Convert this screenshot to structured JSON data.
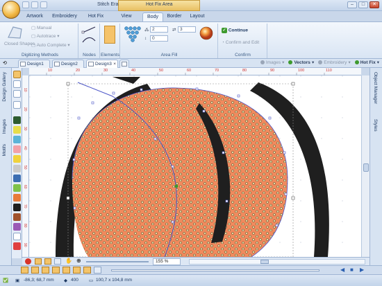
{
  "window": {
    "title": "Stitch Era",
    "contextual_group": "Hot Fix Area",
    "controls": [
      "–",
      "□",
      "✕"
    ]
  },
  "ribbon_tabs": [
    {
      "label": "Artwork",
      "active": false
    },
    {
      "label": "Embroidery",
      "active": false
    },
    {
      "label": "Hot Fix",
      "active": false
    },
    {
      "label": "View",
      "active": false
    },
    {
      "label": "Body",
      "active": true
    },
    {
      "label": "Border",
      "active": false
    },
    {
      "label": "Layout",
      "active": false
    }
  ],
  "ribbon": {
    "digitizing": {
      "big_button": "Closed Shapes",
      "manual": "Manual",
      "autotrace": "Autotrace",
      "auto_complete": "Auto Complete",
      "label": "Digitizing Methods"
    },
    "nodes": {
      "label": "Nodes"
    },
    "elements": {
      "label": "Elements"
    },
    "area_fill": {
      "rows_value": "2",
      "spacing_value": "3",
      "offset_value": "0",
      "offset2_value": "0",
      "label": "Area Fill"
    },
    "confirm": {
      "continue": "Continue",
      "confirm_and_edit": "Confirm and Edit",
      "label": "Confirm"
    }
  },
  "doc_tabs": [
    {
      "label": "Design1",
      "active": false
    },
    {
      "label": "Design2",
      "active": false
    },
    {
      "label": "Design3",
      "active": true
    }
  ],
  "view_toggles": [
    {
      "label": "Images",
      "enabled": false,
      "color": "#9aa6b8"
    },
    {
      "label": "Vectors",
      "enabled": true,
      "color": "#3e9a2e"
    },
    {
      "label": "Embroidery",
      "enabled": false,
      "color": "#9aa6b8"
    },
    {
      "label": "Hot Fix",
      "enabled": true,
      "color": "#3e9a2e"
    }
  ],
  "left_panels": [
    "Design Gallery",
    "Images",
    "Motifs"
  ],
  "right_panels": [
    "Object Manager",
    "Styles"
  ],
  "ruler": {
    "h_ticks": [
      "10",
      "20",
      "30",
      "40",
      "50",
      "60",
      "70",
      "80",
      "90",
      "100",
      "110"
    ],
    "v_ticks": [
      "10",
      "20",
      "30",
      "40",
      "50",
      "60",
      "70",
      "80",
      "90"
    ]
  },
  "zoom": "155 %",
  "status": {
    "coords": "-86,3; 68,7 mm",
    "count": "400",
    "size": "100,7 x 104,8 mm"
  },
  "colors": {
    "fill": "#f08a5d",
    "outline": "#1f1f1f",
    "vector": "#4b55c8",
    "accent": "#e8c063"
  }
}
